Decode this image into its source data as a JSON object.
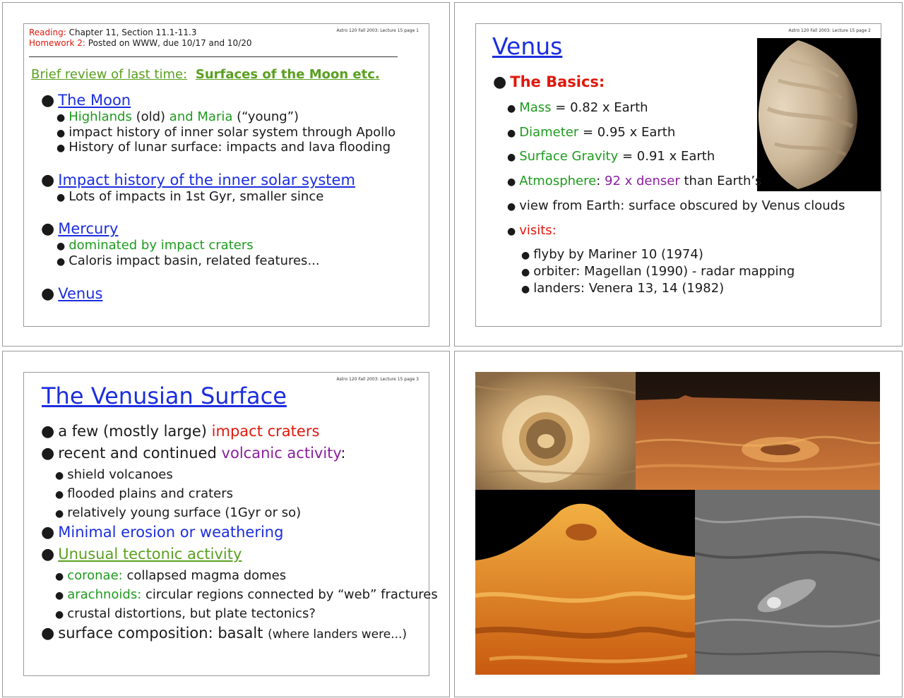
{
  "slide1": {
    "header": "Astro 120 Fall 2003: Lecture 15 page 1",
    "reading_label": "Reading:",
    "reading_text": "Chapter 11, Section 11.1-11.3",
    "homework_label": "Homework 2:",
    "homework_text": "Posted on WWW, due 10/17 and 10/20",
    "review_prefix": "Brief review of last time:",
    "review_title": "Surfaces of the Moon etc.",
    "moon": "The Moon",
    "highlands": "Highlands",
    "old": "(old)",
    "and_maria": "and Maria",
    "young": "(“young”)",
    "moon_b2": "impact history of inner solar system through Apollo",
    "moon_b3": "History of lunar surface: impacts and lava flooding",
    "impact_history": "Impact history of the inner solar system",
    "impact_b1": "Lots of impacts in 1st Gyr, smaller since",
    "mercury": "Mercury",
    "mercury_b1": "dominated by impact craters",
    "mercury_b2": "Caloris impact basin, related features...",
    "venus": "Venus"
  },
  "slide2": {
    "header": "Astro 120 Fall 2003: Lecture 15 page 2",
    "title": "Venus",
    "basics": "The Basics:",
    "mass_label": "Mass",
    "mass_value": "= 0.82 x Earth",
    "diam_label": "Diameter",
    "diam_value": "= 0.95 x Earth",
    "grav_label": "Surface Gravity",
    "grav_value": "= 0.91 x Earth",
    "atm_label": "Atmosphere",
    "atm_colon": ":",
    "atm_dense": "92 x denser",
    "atm_rest": "than Earth’s",
    "view": "view from Earth: surface obscured by Venus clouds",
    "visits": "visits:",
    "v1": "flyby by Mariner 10 (1974)",
    "v2": "orbiter: Magellan (1990) - radar mapping",
    "v3": "landers: Venera 13, 14 (1982)"
  },
  "slide3": {
    "header": "Astro 120 Fall 2003: Lecture 15 page 3",
    "title": "The Venusian Surface",
    "b1_pre": "a few (mostly large)",
    "b1_red": "impact craters",
    "b2_pre": "recent and continued",
    "b2_purple": "volcanic activity",
    "b2_colon": ":",
    "b2_s1": "shield volcanoes",
    "b2_s2": "flooded plains and craters",
    "b2_s3": "relatively young surface (1Gyr or so)",
    "b3": "Minimal erosion or weathering",
    "b4": "Unusual tectonic activity",
    "b4_s1_label": "coronae:",
    "b4_s1_text": "collapsed magma domes",
    "b4_s2_label": "arachnoids:",
    "b4_s2_text": "circular regions connected by “web” fractures",
    "b4_s3": "crustal distortions, but plate tectonics?",
    "b5_main": "surface composition: basalt",
    "b5_small": "(where landers were...)"
  }
}
